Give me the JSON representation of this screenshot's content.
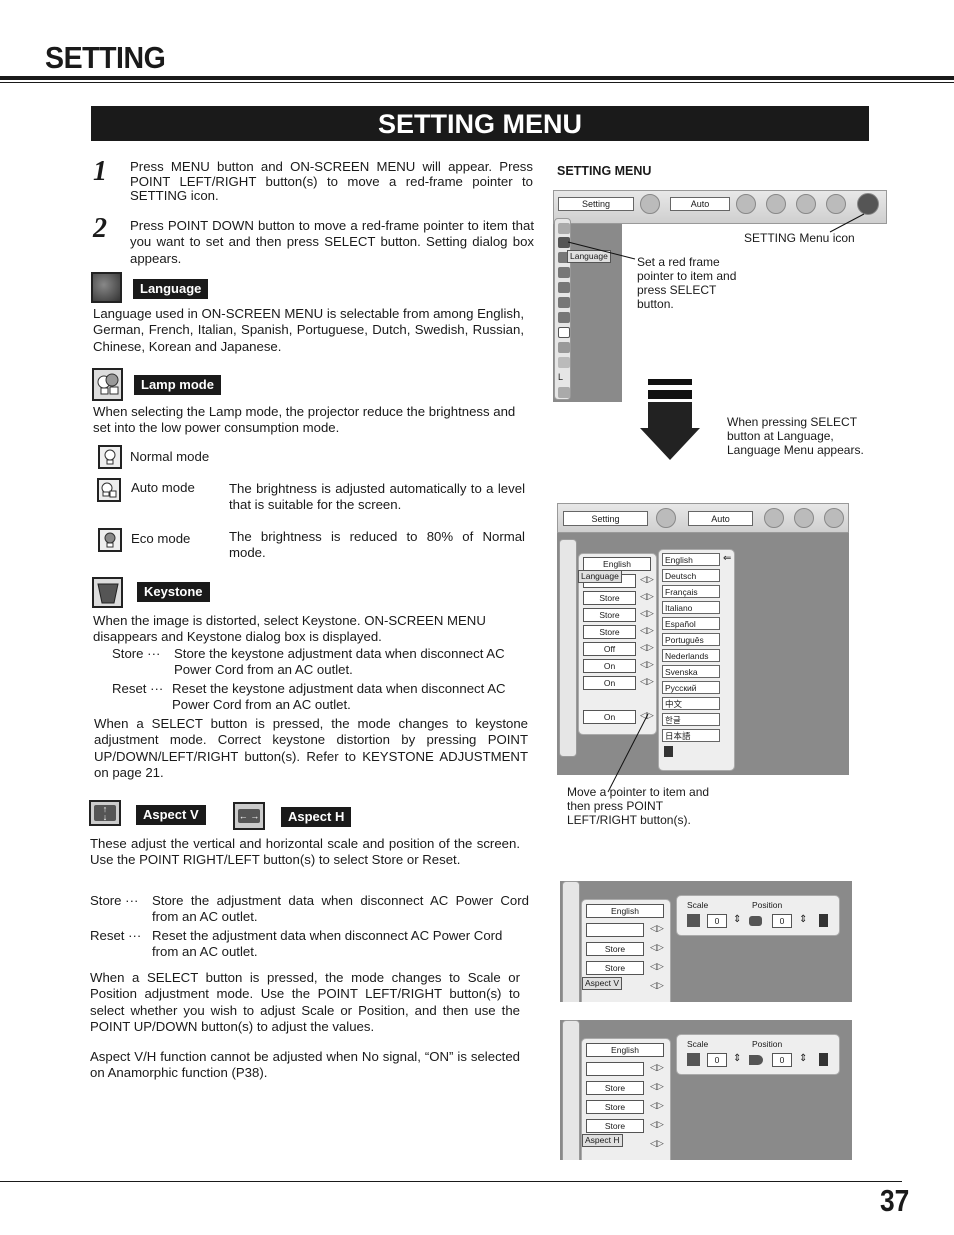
{
  "header": {
    "title": "SETTING",
    "banner": "SETTING MENU"
  },
  "steps": [
    {
      "num": "1",
      "text": "Press MENU button and ON-SCREEN MENU will appear.  Press POINT LEFT/RIGHT button(s) to move a red-frame pointer to SETTING icon."
    },
    {
      "num": "2",
      "text": "Press POINT DOWN button to move a red-frame pointer to item that you want to set and then press SELECT button.  Setting dialog box appears."
    }
  ],
  "language": {
    "label": "Language",
    "text": "Language used in ON-SCREEN MENU is selectable from among English, German, French, Italian, Spanish, Portuguese, Dutch, Swedish, Russian, Chinese, Korean and Japanese."
  },
  "lamp": {
    "label": "Lamp mode",
    "text": "When selecting the Lamp mode, the projector reduce the brightness and set into the low power consumption mode.",
    "modes": [
      {
        "name": "Normal mode",
        "desc": ""
      },
      {
        "name": "Auto mode",
        "desc": "The brightness is adjusted automatically to a level that is suitable for the screen."
      },
      {
        "name": "Eco mode",
        "desc": "The brightness is reduced to 80% of Normal mode."
      }
    ]
  },
  "keystone": {
    "label": "Keystone",
    "intro": "When the image is distorted, select Keystone.  ON-SCREEN MENU disappears and Keystone dialog box is displayed.",
    "store_term": "Store  ···",
    "store_desc": "Store the keystone adjustment data when disconnect AC Power Cord from an AC outlet.",
    "reset_term": "Reset ···",
    "reset_desc": "Reset the keystone adjustment data when disconnect AC Power Cord from an AC outlet.",
    "outro": "When a SELECT button is pressed, the mode changes to keystone adjustment mode. Correct keystone distortion by pressing POINT UP/DOWN/LEFT/RIGHT button(s). Refer to KEYSTONE ADJUSTMENT on page 21."
  },
  "aspect": {
    "label_v": "Aspect V",
    "label_h": "Aspect H",
    "intro": "These adjust the vertical and horizontal scale and position of the screen. Use the POINT RIGHT/LEFT button(s) to select Store or Reset.",
    "store_term": "Store  ···",
    "store_desc": "Store the adjustment data when disconnect AC Power Cord from an AC outlet.",
    "reset_term": "Reset ···",
    "reset_desc": "Reset the adjustment data when disconnect AC Power Cord from an AC outlet.",
    "para2": "When a SELECT button is pressed, the mode changes to Scale or Position adjustment mode. Use the POINT LEFT/RIGHT button(s) to select whether you wish to adjust Scale or Position, and then use the POINT UP/DOWN button(s) to adjust the values.",
    "para3": "Aspect V/H function cannot be adjusted when No signal, “ON” is selected on Anamorphic function (P38)."
  },
  "figures": {
    "heading": "SETTING MENU",
    "osd": {
      "setting": "Setting",
      "auto": "Auto",
      "tooltip_language": "Language"
    },
    "callout_icon": "SETTING Menu icon",
    "callout_frame": "Set a red frame pointer to item and press SELECT button.",
    "callout_select": "When pressing SELECT button at Language, Language Menu appears.",
    "callout_move": "Move a pointer to item and then press POINT LEFT/RIGHT button(s).",
    "menu_values": [
      "English",
      "",
      "Store",
      "Store",
      "Store",
      "Off",
      "On",
      "On",
      "On"
    ],
    "languages": [
      "English",
      "Deutsch",
      "Français",
      "Italiano",
      "Español",
      "Português",
      "Nederlands",
      "Svenska",
      "Русский",
      "中文",
      "한글",
      "日本語"
    ],
    "aspect_v": {
      "tooltip": "Aspect V",
      "first": "English",
      "rows": [
        "",
        "Store",
        "Store"
      ],
      "scale_label": "Scale",
      "position_label": "Position",
      "scale_value": "0",
      "position_value": "0"
    },
    "aspect_h": {
      "tooltip": "Aspect H",
      "first": "English",
      "rows": [
        "",
        "Store",
        "Store",
        "Store"
      ],
      "scale_label": "Scale",
      "position_label": "Position",
      "scale_value": "0",
      "position_value": "0"
    }
  },
  "footer": {
    "page_number": "37"
  }
}
